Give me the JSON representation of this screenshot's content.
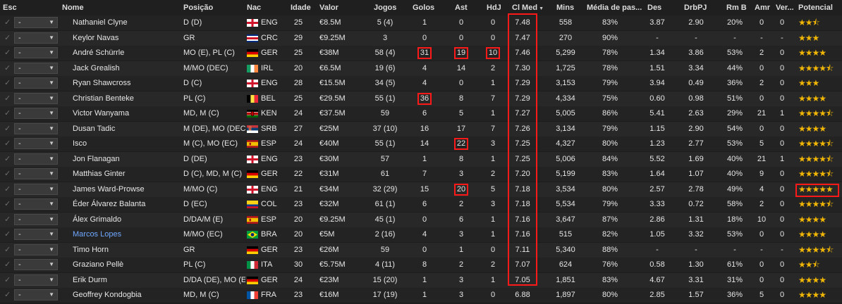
{
  "header": {
    "esc": "Esc",
    "nome": "Nome",
    "posicao": "Posição",
    "nac": "Nac",
    "idade": "Idade",
    "valor": "Valor",
    "jogos": "Jogos",
    "golos": "Golos",
    "ast": "Ast",
    "hdj": "HdJ",
    "clmed": "Cl Med",
    "mins": "Mins",
    "media_passes": "Média de pas...",
    "des": "Des",
    "drbpj": "DrbPJ",
    "rmb": "Rm B",
    "amr": "Amr",
    "ver": "Ver...",
    "potencial": "Potencial"
  },
  "dropdown_value": "-",
  "colors": {
    "highlight": "#ff1a1a",
    "star": "#f2b705",
    "link": "#6fa8ff"
  },
  "players": [
    {
      "nome": "Nathaniel Clyne",
      "posicao": "D (D)",
      "nac": "ENG",
      "idade": "25",
      "valor": "€8.5M",
      "jogos": "5 (4)",
      "golos": "1",
      "ast": "0",
      "hdj": "0",
      "clmed": "7.48",
      "mins": "558",
      "media": "83%",
      "des": "3.87",
      "drbpj": "2.90",
      "rmb": "20%",
      "amr": "0",
      "ver": "0",
      "stars": 2.5
    },
    {
      "nome": "Keylor Navas",
      "posicao": "GR",
      "nac": "CRC",
      "idade": "29",
      "valor": "€9.25M",
      "jogos": "3",
      "golos": "0",
      "ast": "0",
      "hdj": "0",
      "clmed": "7.47",
      "mins": "270",
      "media": "90%",
      "des": "-",
      "drbpj": "-",
      "rmb": "-",
      "amr": "-",
      "ver": "-",
      "stars": 3
    },
    {
      "nome": "André Schürrle",
      "posicao": "MO (E), PL (C)",
      "nac": "GER",
      "idade": "25",
      "valor": "€38M",
      "jogos": "58 (4)",
      "golos": "31",
      "ast": "19",
      "hdj": "10",
      "clmed": "7.46",
      "mins": "5,299",
      "media": "78%",
      "des": "1.34",
      "drbpj": "3.86",
      "rmb": "53%",
      "amr": "2",
      "ver": "0",
      "stars": 4
    },
    {
      "nome": "Jack Grealish",
      "posicao": "M/MO (DEC)",
      "nac": "IRL",
      "idade": "20",
      "valor": "€6.5M",
      "jogos": "19 (6)",
      "golos": "4",
      "ast": "14",
      "hdj": "2",
      "clmed": "7.30",
      "mins": "1,725",
      "media": "78%",
      "des": "1.51",
      "drbpj": "3.34",
      "rmb": "44%",
      "amr": "0",
      "ver": "0",
      "stars": 4.5
    },
    {
      "nome": "Ryan Shawcross",
      "posicao": "D (C)",
      "nac": "ENG",
      "idade": "28",
      "valor": "€15.5M",
      "jogos": "34 (5)",
      "golos": "4",
      "ast": "0",
      "hdj": "1",
      "clmed": "7.29",
      "mins": "3,153",
      "media": "79%",
      "des": "3.94",
      "drbpj": "0.49",
      "rmb": "36%",
      "amr": "2",
      "ver": "0",
      "stars": 3
    },
    {
      "nome": "Christian Benteke",
      "posicao": "PL (C)",
      "nac": "BEL",
      "idade": "25",
      "valor": "€29.5M",
      "jogos": "55 (1)",
      "golos": "36",
      "ast": "8",
      "hdj": "7",
      "clmed": "7.29",
      "mins": "4,334",
      "media": "75%",
      "des": "0.60",
      "drbpj": "0.98",
      "rmb": "51%",
      "amr": "0",
      "ver": "0",
      "stars": 4
    },
    {
      "nome": "Victor Wanyama",
      "posicao": "MD, M (C)",
      "nac": "KEN",
      "idade": "24",
      "valor": "€37.5M",
      "jogos": "59",
      "golos": "6",
      "ast": "5",
      "hdj": "1",
      "clmed": "7.27",
      "mins": "5,005",
      "media": "86%",
      "des": "5.41",
      "drbpj": "2.63",
      "rmb": "29%",
      "amr": "21",
      "ver": "1",
      "stars": 4.5
    },
    {
      "nome": "Dusan Tadic",
      "posicao": "M (DE), MO (DEC)",
      "nac": "SRB",
      "idade": "27",
      "valor": "€25M",
      "jogos": "37 (10)",
      "golos": "16",
      "ast": "17",
      "hdj": "7",
      "clmed": "7.26",
      "mins": "3,134",
      "media": "79%",
      "des": "1.15",
      "drbpj": "2.90",
      "rmb": "54%",
      "amr": "0",
      "ver": "0",
      "stars": 4
    },
    {
      "nome": "Isco",
      "posicao": "M (C), MO (EC)",
      "nac": "ESP",
      "idade": "24",
      "valor": "€40M",
      "jogos": "55 (1)",
      "golos": "14",
      "ast": "22",
      "hdj": "3",
      "clmed": "7.25",
      "mins": "4,327",
      "media": "80%",
      "des": "1.23",
      "drbpj": "2.77",
      "rmb": "53%",
      "amr": "5",
      "ver": "0",
      "stars": 4.5
    },
    {
      "nome": "Jon Flanagan",
      "posicao": "D (DE)",
      "nac": "ENG",
      "idade": "23",
      "valor": "€30M",
      "jogos": "57",
      "golos": "1",
      "ast": "8",
      "hdj": "1",
      "clmed": "7.25",
      "mins": "5,006",
      "media": "84%",
      "des": "5.52",
      "drbpj": "1.69",
      "rmb": "40%",
      "amr": "21",
      "ver": "1",
      "stars": 4.5
    },
    {
      "nome": "Matthias Ginter",
      "posicao": "D (C), MD, M (C)",
      "nac": "GER",
      "idade": "22",
      "valor": "€31M",
      "jogos": "61",
      "golos": "7",
      "ast": "3",
      "hdj": "2",
      "clmed": "7.20",
      "mins": "5,199",
      "media": "83%",
      "des": "1.64",
      "drbpj": "1.07",
      "rmb": "40%",
      "amr": "9",
      "ver": "0",
      "stars": 4.5
    },
    {
      "nome": "James Ward-Prowse",
      "posicao": "M/MO (C)",
      "nac": "ENG",
      "idade": "21",
      "valor": "€34M",
      "jogos": "32 (29)",
      "golos": "15",
      "ast": "20",
      "hdj": "5",
      "clmed": "7.18",
      "mins": "3,534",
      "media": "80%",
      "des": "2.57",
      "drbpj": "2.78",
      "rmb": "49%",
      "amr": "4",
      "ver": "0",
      "stars": 5
    },
    {
      "nome": "Éder Álvarez Balanta",
      "posicao": "D (EC)",
      "nac": "COL",
      "idade": "23",
      "valor": "€32M",
      "jogos": "61 (1)",
      "golos": "6",
      "ast": "2",
      "hdj": "3",
      "clmed": "7.18",
      "mins": "5,534",
      "media": "79%",
      "des": "3.33",
      "drbpj": "0.72",
      "rmb": "58%",
      "amr": "2",
      "ver": "0",
      "stars": 4.5
    },
    {
      "nome": "Álex Grimaldo",
      "posicao": "D/DA/M (E)",
      "nac": "ESP",
      "idade": "20",
      "valor": "€9.25M",
      "jogos": "45 (1)",
      "golos": "0",
      "ast": "6",
      "hdj": "1",
      "clmed": "7.16",
      "mins": "3,647",
      "media": "87%",
      "des": "2.86",
      "drbpj": "1.31",
      "rmb": "18%",
      "amr": "10",
      "ver": "0",
      "stars": 4
    },
    {
      "nome": "Marcos Lopes",
      "posicao": "M/MO (EC)",
      "nac": "BRA",
      "idade": "20",
      "valor": "€5M",
      "jogos": "2 (16)",
      "golos": "4",
      "ast": "3",
      "hdj": "1",
      "clmed": "7.16",
      "mins": "515",
      "media": "82%",
      "des": "1.05",
      "drbpj": "3.32",
      "rmb": "53%",
      "amr": "0",
      "ver": "0",
      "stars": 4,
      "link": true
    },
    {
      "nome": "Timo Horn",
      "posicao": "GR",
      "nac": "GER",
      "idade": "23",
      "valor": "€26M",
      "jogos": "59",
      "golos": "0",
      "ast": "1",
      "hdj": "0",
      "clmed": "7.11",
      "mins": "5,340",
      "media": "88%",
      "des": "-",
      "drbpj": "-",
      "rmb": "-",
      "amr": "-",
      "ver": "-",
      "stars": 4.5
    },
    {
      "nome": "Graziano Pellè",
      "posicao": "PL (C)",
      "nac": "ITA",
      "idade": "30",
      "valor": "€5.75M",
      "jogos": "4 (11)",
      "golos": "8",
      "ast": "2",
      "hdj": "2",
      "clmed": "7.07",
      "mins": "624",
      "media": "76%",
      "des": "0.58",
      "drbpj": "1.30",
      "rmb": "61%",
      "amr": "0",
      "ver": "0",
      "stars": 2.5
    },
    {
      "nome": "Erik Durm",
      "posicao": "D/DA (DE), MO (E)",
      "nac": "GER",
      "idade": "24",
      "valor": "€23M",
      "jogos": "15 (20)",
      "golos": "1",
      "ast": "3",
      "hdj": "1",
      "clmed": "7.05",
      "mins": "1,851",
      "media": "83%",
      "des": "4.67",
      "drbpj": "3.31",
      "rmb": "31%",
      "amr": "0",
      "ver": "0",
      "stars": 4
    },
    {
      "nome": "Geoffrey Kondogbia",
      "posicao": "MD, M (C)",
      "nac": "FRA",
      "idade": "23",
      "valor": "€16M",
      "jogos": "17 (19)",
      "golos": "1",
      "ast": "3",
      "hdj": "0",
      "clmed": "6.88",
      "mins": "1,897",
      "media": "80%",
      "des": "2.85",
      "drbpj": "1.57",
      "rmb": "36%",
      "amr": "5",
      "ver": "0",
      "stars": 4
    }
  ],
  "highlighted_cells": [
    {
      "row": 2,
      "col": "golos"
    },
    {
      "row": 2,
      "col": "ast"
    },
    {
      "row": 2,
      "col": "hdj"
    },
    {
      "row": 5,
      "col": "golos"
    },
    {
      "row": 8,
      "col": "ast"
    },
    {
      "row": 11,
      "col": "ast"
    }
  ]
}
